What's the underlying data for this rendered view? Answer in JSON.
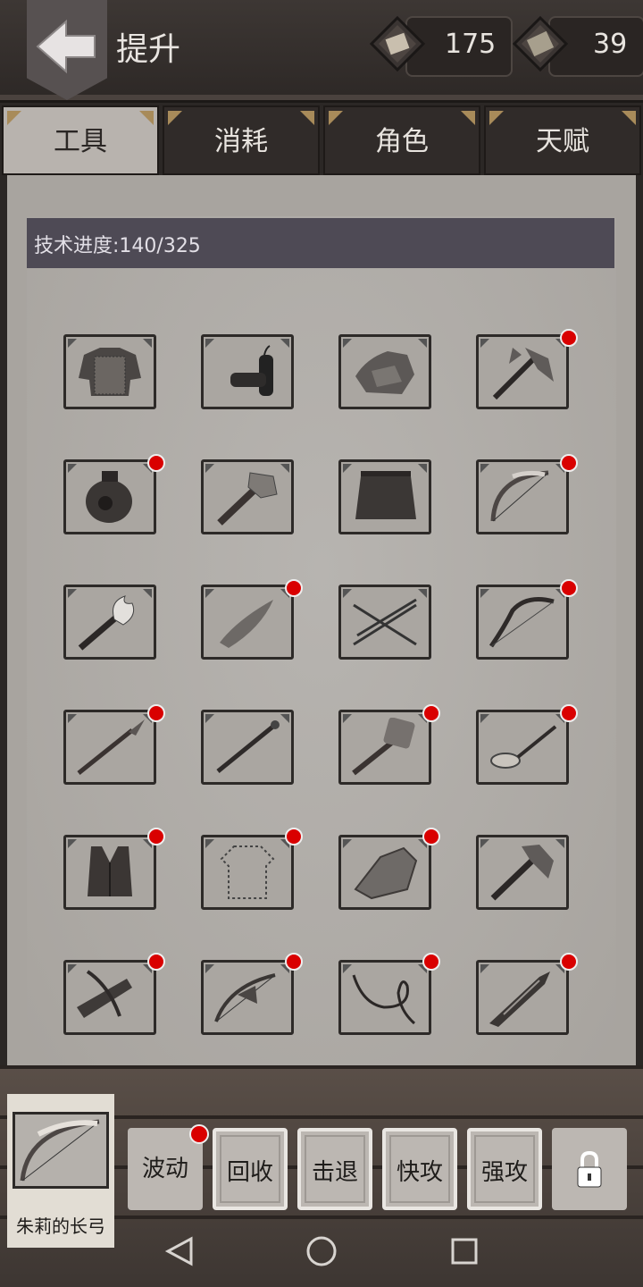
{
  "header": {
    "title": "提升",
    "resources": [
      {
        "icon": "parchment-scroll-icon",
        "value": "175"
      },
      {
        "icon": "book-icon",
        "value": "39"
      }
    ]
  },
  "tabs": [
    {
      "label": "工具",
      "active": true
    },
    {
      "label": "消耗",
      "active": false
    },
    {
      "label": "角色",
      "active": false
    },
    {
      "label": "天赋",
      "active": false
    }
  ],
  "progress": {
    "text": "技术进度:140/325"
  },
  "items": [
    {
      "icon": "chainmail-armor-icon",
      "badge": false
    },
    {
      "icon": "dynamite-icon",
      "badge": false
    },
    {
      "icon": "stone-armor-icon",
      "badge": false
    },
    {
      "icon": "battle-axe-icon",
      "badge": true
    },
    {
      "icon": "poison-jar-icon",
      "badge": true
    },
    {
      "icon": "stone-hammer-icon",
      "badge": false
    },
    {
      "icon": "grass-skirt-icon",
      "badge": false
    },
    {
      "icon": "bone-bow-icon",
      "badge": true
    },
    {
      "icon": "fire-torch-icon",
      "badge": false
    },
    {
      "icon": "stone-knife-icon",
      "badge": true
    },
    {
      "icon": "arrows-icon",
      "badge": false
    },
    {
      "icon": "recurve-bow-icon",
      "badge": true
    },
    {
      "icon": "spear-icon",
      "badge": true
    },
    {
      "icon": "staff-icon",
      "badge": false
    },
    {
      "icon": "sledgehammer-icon",
      "badge": true
    },
    {
      "icon": "frying-pan-icon",
      "badge": true
    },
    {
      "icon": "leather-vest-icon",
      "badge": true
    },
    {
      "icon": "empty-shirt-outline-icon",
      "badge": true
    },
    {
      "icon": "rock-icon",
      "badge": true
    },
    {
      "icon": "double-axe-icon",
      "badge": false
    },
    {
      "icon": "crossbow-icon",
      "badge": true
    },
    {
      "icon": "bow-crossbow-icon",
      "badge": true
    },
    {
      "icon": "whip-icon",
      "badge": true
    },
    {
      "icon": "jagged-sword-icon",
      "badge": true
    }
  ],
  "selected": {
    "name": "朱莉的长弓",
    "icon": "longbow-icon"
  },
  "skills": [
    {
      "label": "波动",
      "framed": false,
      "badge": true
    },
    {
      "label": "回收",
      "framed": true,
      "badge": false
    },
    {
      "label": "击退",
      "framed": true,
      "badge": false
    },
    {
      "label": "快攻",
      "framed": true,
      "badge": false
    },
    {
      "label": "强攻",
      "framed": true,
      "badge": false
    }
  ],
  "colors": {
    "badge": "#d90000",
    "tab_active": "#b8b3ae",
    "progress_bar": "#4e4a55"
  }
}
